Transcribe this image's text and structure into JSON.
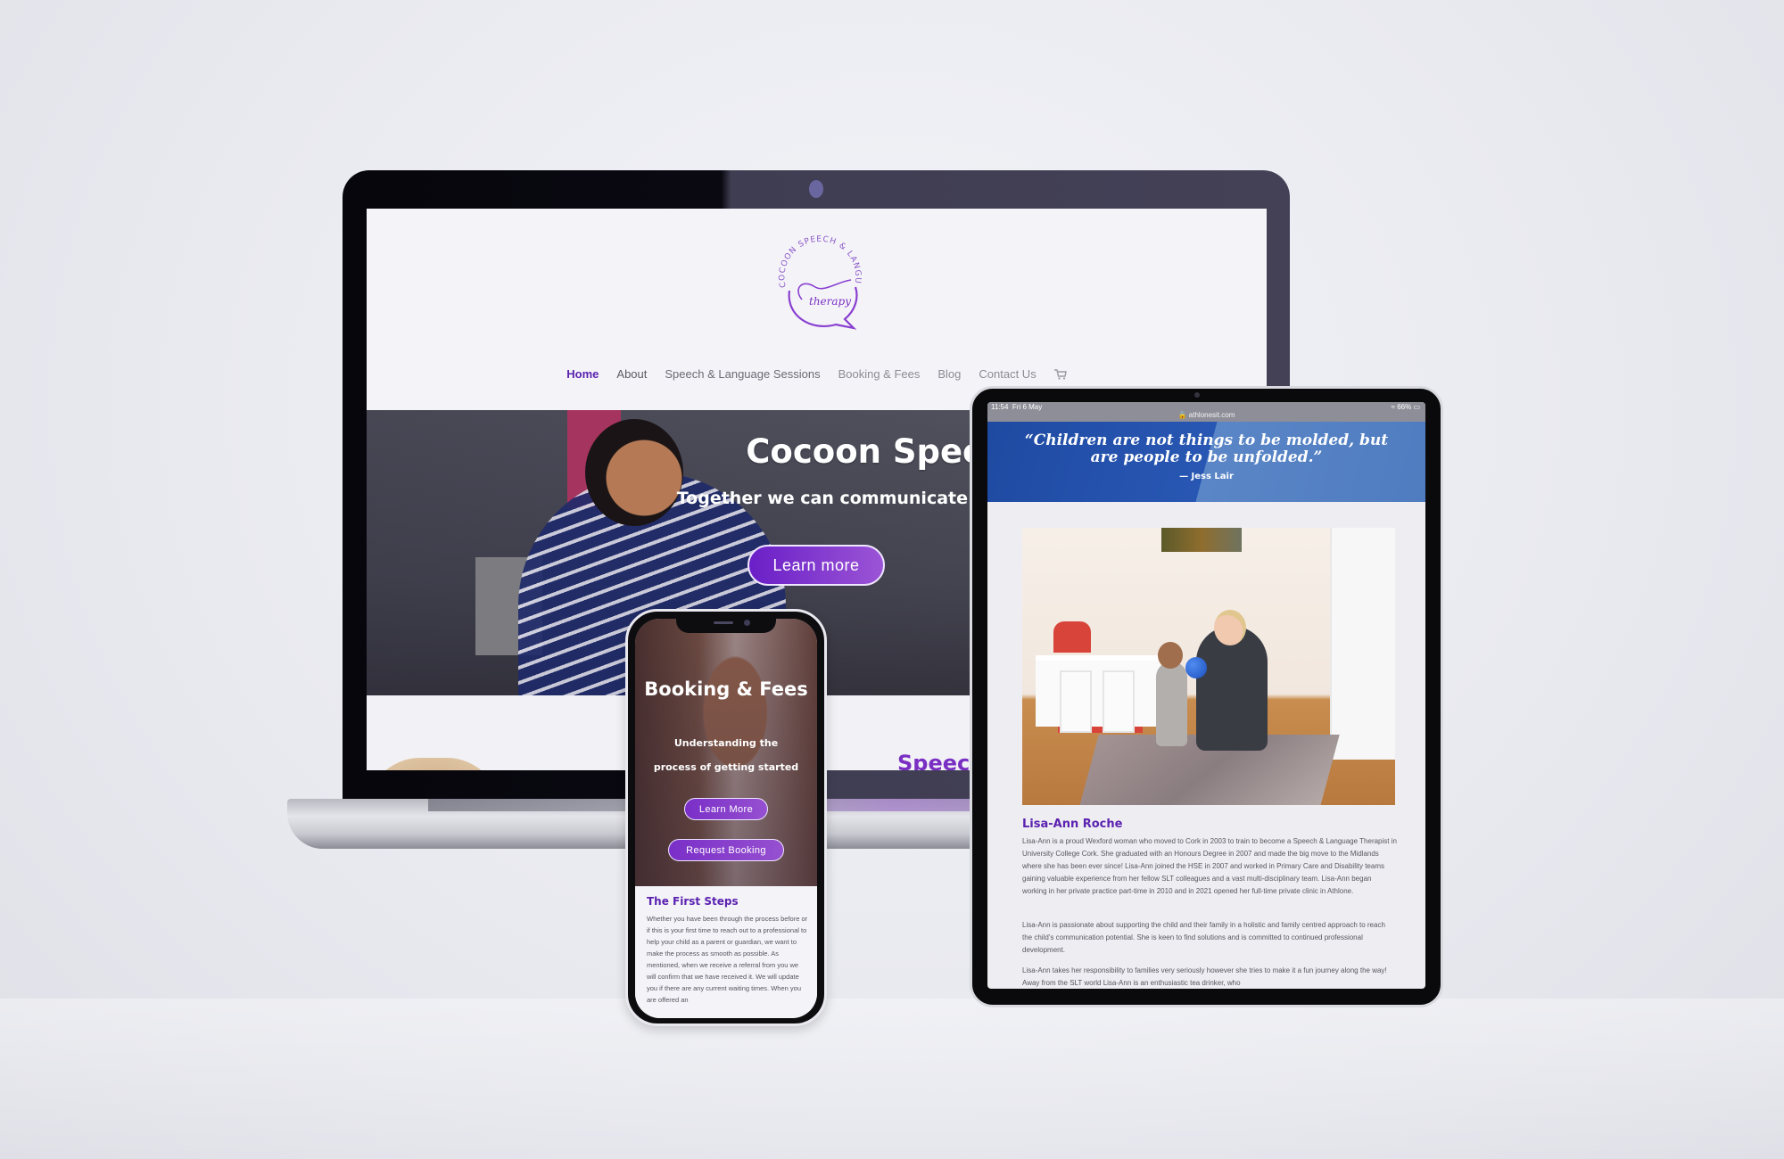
{
  "laptop": {
    "logo": {
      "arc_text": "COCOON SPEECH & LANGUAGE",
      "script_text": "therapy"
    },
    "nav": {
      "items": [
        {
          "label": "Home",
          "active": true
        },
        {
          "label": "About",
          "active": false
        },
        {
          "label": "Speech & Language Sessions",
          "active": false
        },
        {
          "label": "Booking & Fees",
          "active": false
        },
        {
          "label": "Blog",
          "active": false
        },
        {
          "label": "Contact Us",
          "active": false
        }
      ],
      "cart_icon": "shopping-cart-icon"
    },
    "hero": {
      "title": "Cocoon Speech & Language",
      "subtitle": "Together we can communicate",
      "button_label": "Learn more"
    },
    "next_section_heading": "Speech"
  },
  "tablet": {
    "status": {
      "time": "11:54",
      "date": "Fri 6 May",
      "url": "athlonesit.com",
      "battery": "66%"
    },
    "quote": {
      "text": "“Children are not things to be molded, but are people to be unfolded.”",
      "author": "— Jess Lair"
    },
    "profile": {
      "name": "Lisa-Ann Roche",
      "paragraphs": [
        "Lisa-Ann is a proud Wexford woman who moved to Cork in 2003 to train to become a Speech & Language Therapist in University College Cork. She graduated with an Honours Degree in 2007 and made the big move to the Midlands where she has been ever since! Lisa-Ann joined the HSE in 2007 and worked in Primary Care and Disability teams gaining valuable experience from her fellow SLT colleagues and a vast multi-disciplinary team. Lisa-Ann began working in her private practice part-time in 2010 and in 2021 opened her full-time private clinic in Athlone.",
        "Lisa-Ann is passionate about supporting the child and their family in a holistic and family centred approach to reach the child’s communication potential.  She is keen to find solutions and is committed to continued professional development.",
        "Lisa-Ann takes her responsibility to families very seriously however she tries to make it a fun journey along the way!  Away from the SLT world Lisa-Ann is an enthusiastic tea drinker, who"
      ]
    }
  },
  "phone": {
    "hero": {
      "title": "Booking & Fees",
      "subtitle_line1": "Understanding the",
      "subtitle_line2": "process of getting started",
      "learn_more_label": "Learn More",
      "request_booking_label": "Request Booking"
    },
    "section": {
      "heading": "The First Steps",
      "body": "Whether you have been through the process before or if this is your first time to reach out to a professional to help your child as a parent or guardian, we want to make the process as smooth as possible. As mentioned, when we receive a referral from you we will confirm that we have received it. We will update you if there are any current waiting times. When you are offered an"
    }
  },
  "colors": {
    "brand_purple": "#5b22b0",
    "button_purple": "#7a2fc8",
    "quote_blue": "#2857b3"
  }
}
